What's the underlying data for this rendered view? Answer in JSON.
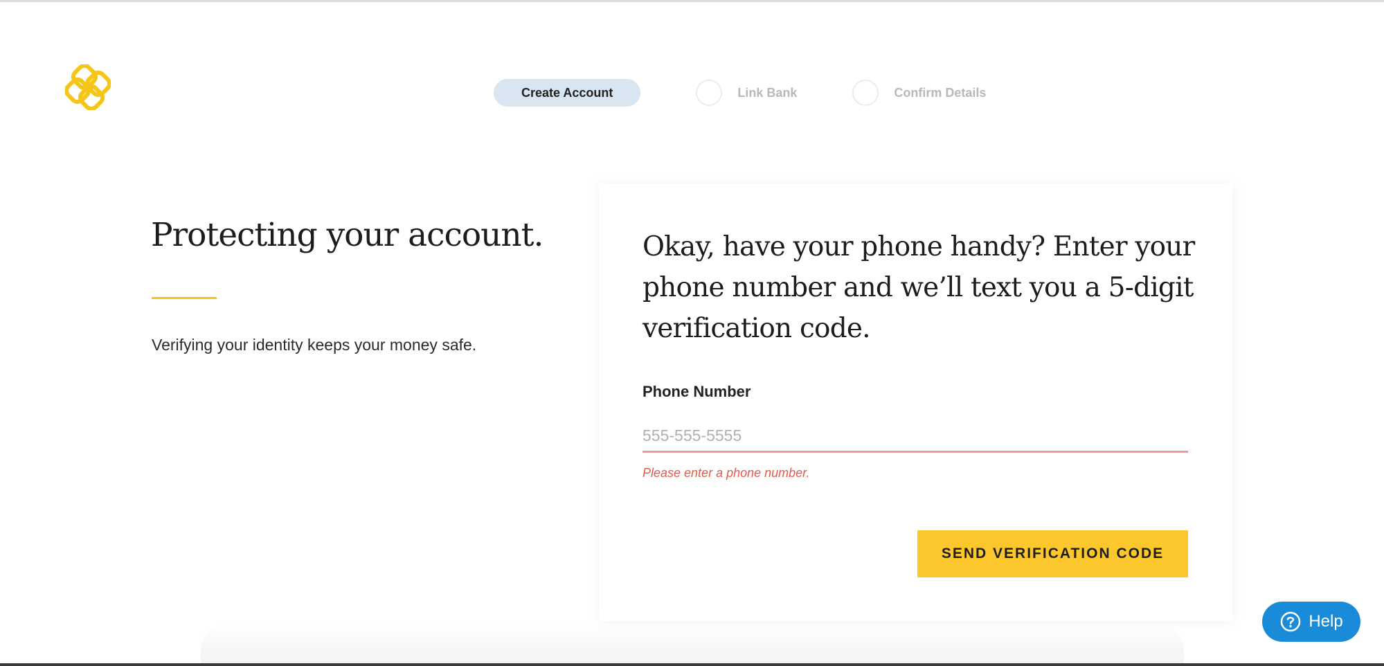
{
  "brand": {
    "logo_icon": "interlocked-rings-logo-icon",
    "accent_color": "#f5c518"
  },
  "stepper": {
    "steps": [
      {
        "label": "Create Account",
        "state": "active"
      },
      {
        "label": "Link Bank",
        "state": "pending"
      },
      {
        "label": "Confirm Details",
        "state": "pending"
      }
    ]
  },
  "intro": {
    "title": "Protecting your account.",
    "subtitle": "Verifying your identity keeps your money safe."
  },
  "form": {
    "heading": "Okay, have your phone handy? Enter your phone number and we’ll text you a 5-digit verification code.",
    "phone_label": "Phone Number",
    "phone_placeholder": "555-555-5555",
    "phone_value": "",
    "error": "Please enter a phone number.",
    "submit_label": "SEND VERIFICATION CODE",
    "submit_color": "#fcc72c",
    "error_color": "#e4594c"
  },
  "help": {
    "label": "Help",
    "icon": "question-circle-icon",
    "color": "#1a8bd8"
  }
}
